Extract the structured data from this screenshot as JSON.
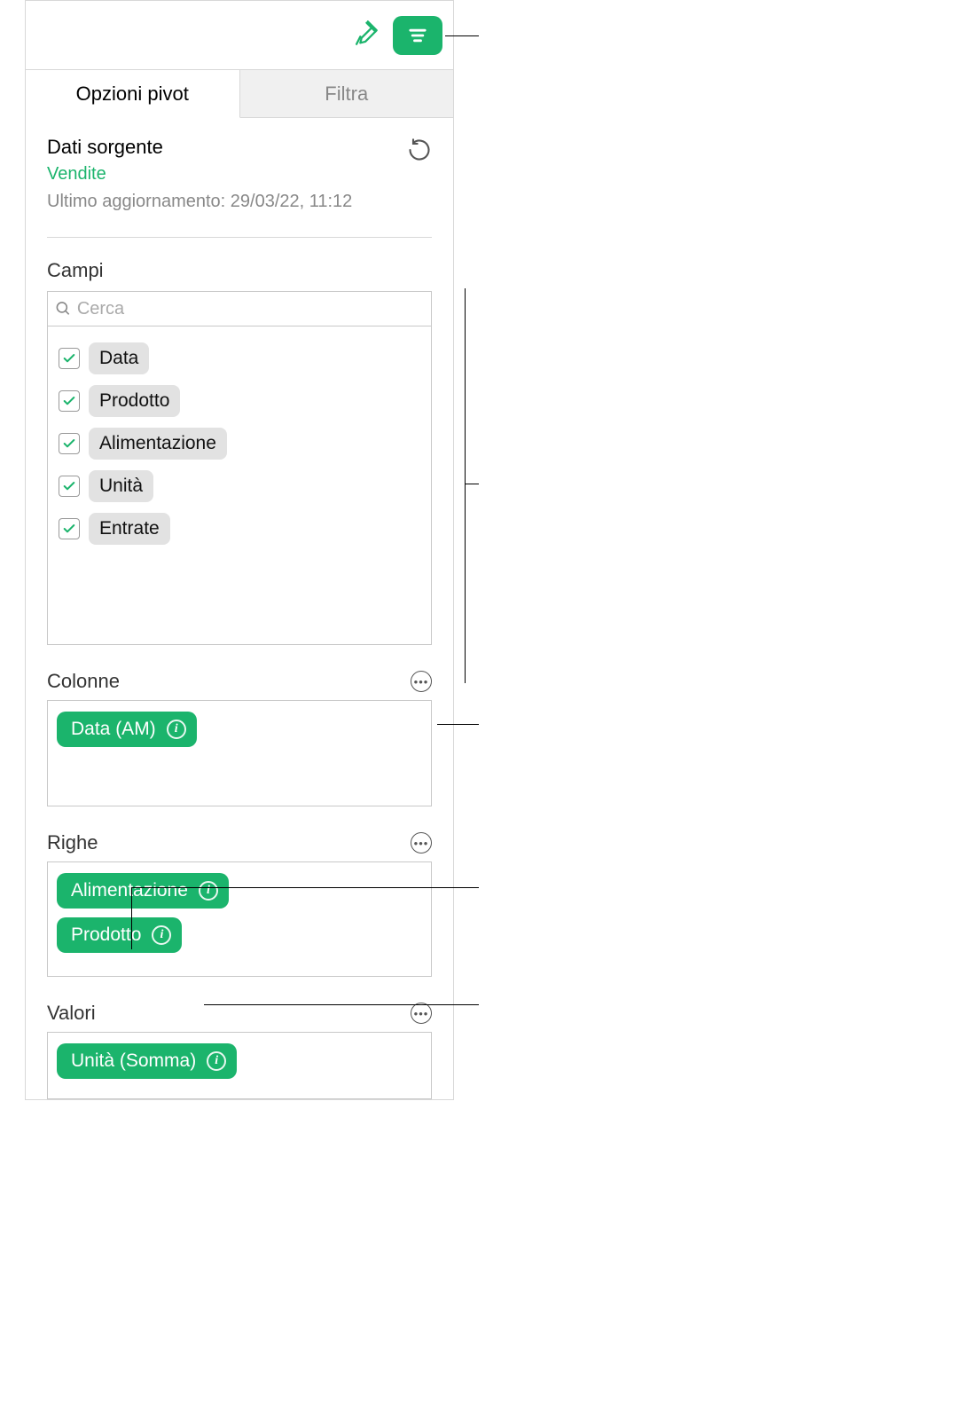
{
  "toolbar": {},
  "tabs": {
    "pivot": "Opzioni pivot",
    "filter": "Filtra"
  },
  "source": {
    "label": "Dati sorgente",
    "name": "Vendite",
    "updated": "Ultimo aggiornamento: 29/03/22, 11:12"
  },
  "fields": {
    "label": "Campi",
    "search_placeholder": "Cerca",
    "items": [
      {
        "label": "Data",
        "checked": true
      },
      {
        "label": "Prodotto",
        "checked": true
      },
      {
        "label": "Alimentazione",
        "checked": true
      },
      {
        "label": "Unità",
        "checked": true
      },
      {
        "label": "Entrate",
        "checked": true
      }
    ]
  },
  "columns": {
    "label": "Colonne",
    "items": [
      {
        "label": "Data (AM)"
      }
    ]
  },
  "rows": {
    "label": "Righe",
    "items": [
      {
        "label": "Alimentazione"
      },
      {
        "label": "Prodotto"
      }
    ]
  },
  "values": {
    "label": "Valori",
    "items": [
      {
        "label": "Unità (Somma)"
      }
    ]
  }
}
